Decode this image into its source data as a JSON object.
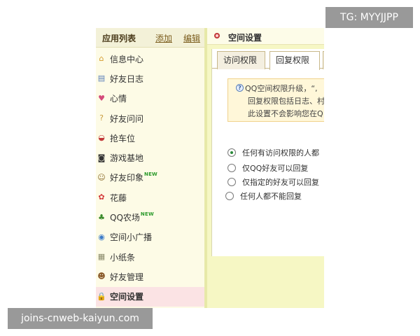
{
  "sidebar": {
    "title": "应用列表",
    "add_label": "添加",
    "edit_label": "编辑",
    "items": [
      {
        "label": "信息中心",
        "icon": "home-icon",
        "glyph": "⌂",
        "color": "#d49a2a"
      },
      {
        "label": "好友日志",
        "icon": "document-icon",
        "glyph": "▤",
        "color": "#5a7fb8"
      },
      {
        "label": "心情",
        "icon": "heart-icon",
        "glyph": "♥",
        "color": "#d44a7a"
      },
      {
        "label": "好友问问",
        "icon": "question-icon",
        "glyph": "?",
        "color": "#c89a3a"
      },
      {
        "label": "抢车位",
        "icon": "car-icon",
        "glyph": "◒",
        "color": "#c23a3a"
      },
      {
        "label": "游戏基地",
        "icon": "gamepad-icon",
        "glyph": "◙",
        "color": "#333333"
      },
      {
        "label": "好友印象",
        "icon": "person-icon",
        "glyph": "☺",
        "color": "#8a6a2a",
        "badge": "NEW"
      },
      {
        "label": "花藤",
        "icon": "flower-icon",
        "glyph": "✿",
        "color": "#d43a3a"
      },
      {
        "label": "QQ农场",
        "icon": "sprout-icon",
        "glyph": "♣",
        "color": "#3a8a2a",
        "badge": "NEW"
      },
      {
        "label": "空间小广播",
        "icon": "broadcast-icon",
        "glyph": "◉",
        "color": "#3a7ac8"
      },
      {
        "label": "小纸条",
        "icon": "note-icon",
        "glyph": "▦",
        "color": "#8a8a6a"
      },
      {
        "label": "好友管理",
        "icon": "friends-icon",
        "glyph": "☻",
        "color": "#8a5a2a"
      },
      {
        "label": "空间设置",
        "icon": "lock-icon",
        "glyph": "🔒",
        "color": "#c89a2a",
        "active": true
      }
    ]
  },
  "content": {
    "title": "空间设置",
    "tabs": [
      "访问权限",
      "回复权限",
      ""
    ],
    "active_tab": 1,
    "notice": {
      "line1": "QQ空间权限升级，“,",
      "line2": "回复权限包括日志、村",
      "line3": "此设置不会影响您在Q"
    },
    "options": [
      {
        "label": "任何有访问权限的人都",
        "checked": true
      },
      {
        "label": "仅QQ好友可以回复",
        "checked": false
      },
      {
        "label": "仅指定的好友可以回复",
        "checked": false
      },
      {
        "label": "任何人都不能回复",
        "checked": false
      }
    ]
  },
  "watermarks": {
    "top": "TG: MYYJJPP",
    "bottom": "joins-cnweb-kaiyun.com"
  },
  "colors": {
    "sidebar_bg": "#fdfbe6",
    "content_bg": "#f6f7c4",
    "active_item_bg": "#fbe3e4",
    "new_badge": "#2a9a2a",
    "radio_checked": "#2a8a3a"
  }
}
